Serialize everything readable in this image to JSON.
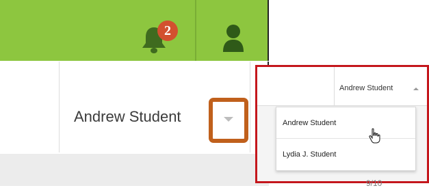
{
  "header": {
    "notifications": {
      "icon": "bell-icon",
      "count": "2"
    },
    "avatar_icon": "person-icon",
    "user_name": "Andrew Student",
    "dropdown_icon": "caret-down-icon"
  },
  "dropdown": {
    "current_user": "Andrew Student",
    "caret_icon": "caret-up-icon",
    "items": [
      {
        "label": "Andrew Student"
      },
      {
        "label": "Lydia J. Student"
      }
    ]
  },
  "page_number": "9/10",
  "colors": {
    "header_green": "#8dc63f",
    "badge_red": "#d2502f",
    "highlight_orange": "#c0601c",
    "inset_border_red": "#c4161c"
  }
}
